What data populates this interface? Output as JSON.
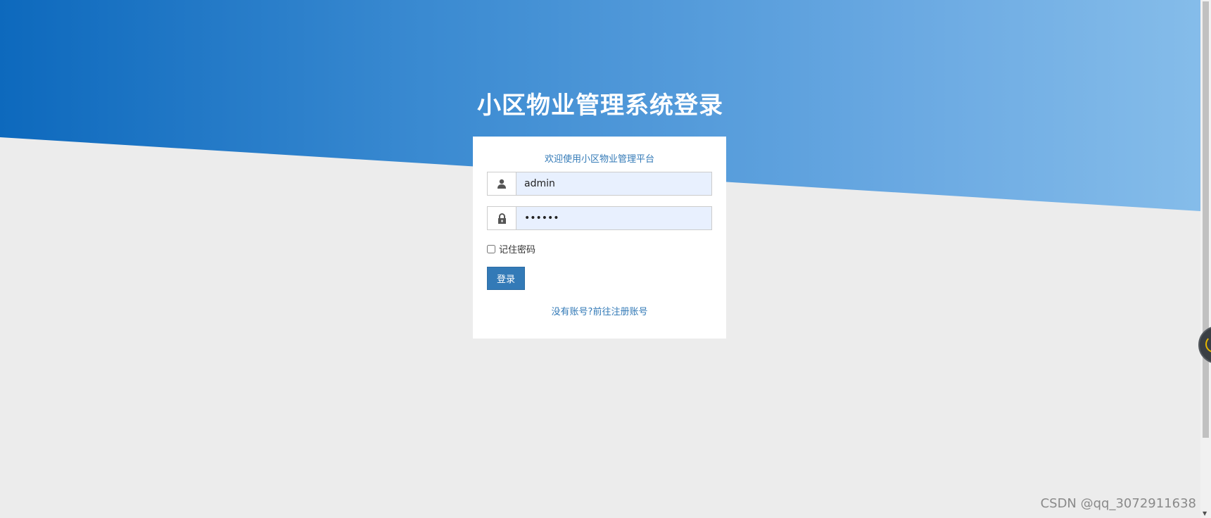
{
  "header": {
    "title": "小区物业管理系统登录"
  },
  "login": {
    "welcome": "欢迎使用小区物业管理平台",
    "username_icon": "user-icon",
    "username_value": "admin",
    "password_icon": "lock-icon",
    "password_value": "••••••",
    "remember_label": "记住密码",
    "remember_checked": false,
    "submit_label": "登录",
    "register_link": "没有账号?前往注册账号"
  },
  "watermark": {
    "text": "CSDN @qq_3072911638"
  },
  "colors": {
    "gradient_start": "#0d69bd",
    "gradient_end": "#86bdea",
    "accent": "#337ab7",
    "background": "#ececec"
  }
}
